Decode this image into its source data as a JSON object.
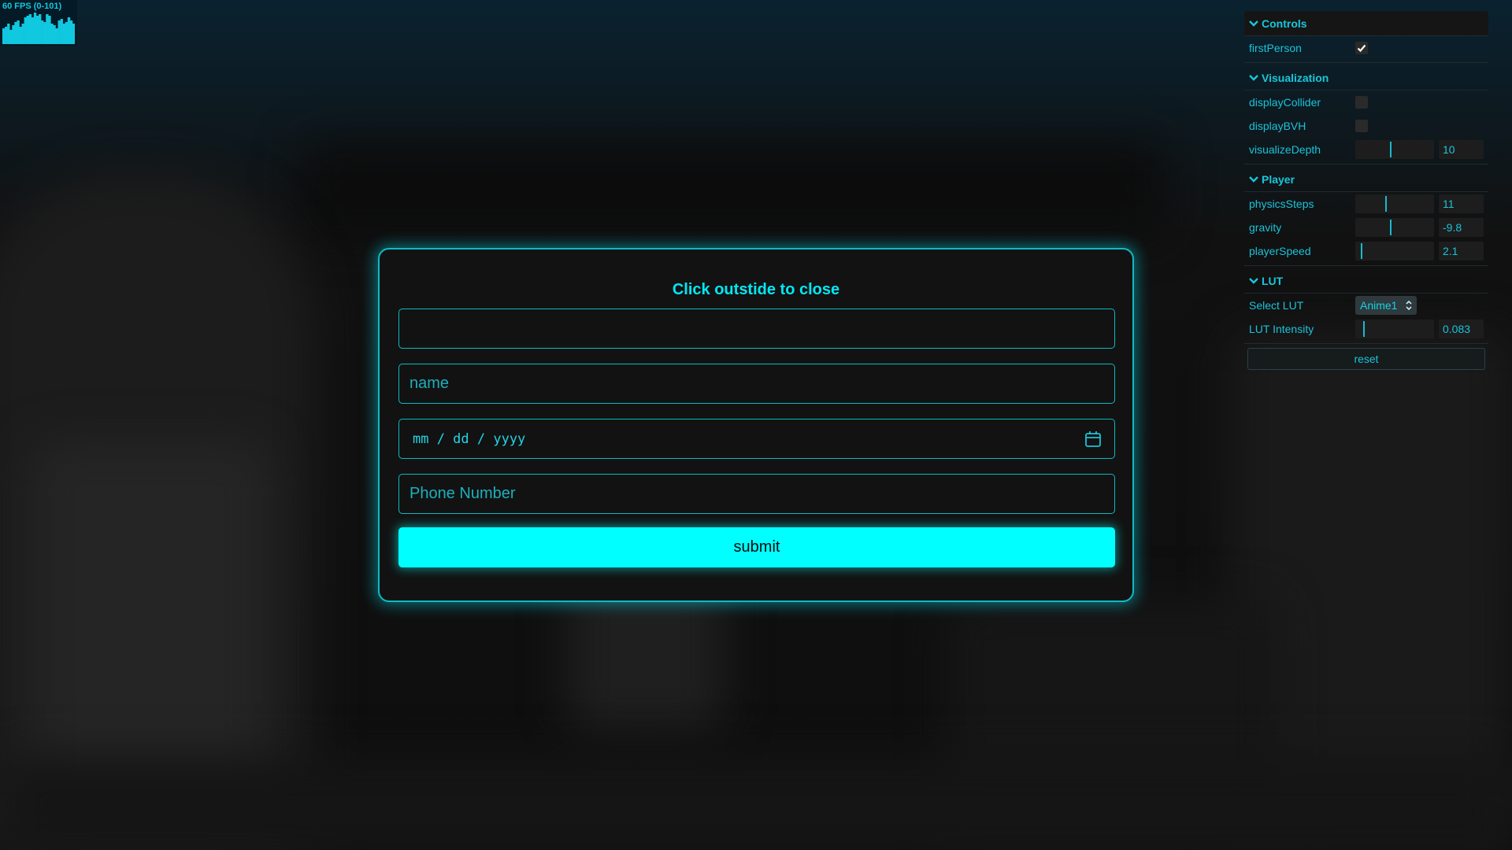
{
  "fps": {
    "label": "60 FPS (0-101)",
    "bars": [
      20,
      22,
      26,
      18,
      24,
      28,
      30,
      22,
      26,
      34,
      36,
      38,
      34,
      40,
      36,
      38,
      30,
      28,
      38,
      36,
      26,
      24,
      20,
      30,
      32,
      26,
      28,
      34,
      30,
      26
    ]
  },
  "modal": {
    "title": "Click outstide to close",
    "field1_placeholder": "",
    "name_placeholder": "name",
    "date_placeholder": "mm / dd / yyyy",
    "phone_placeholder": "Phone Number",
    "submit_label": "submit"
  },
  "gui": {
    "controls": {
      "title": "Controls",
      "first_person_label": "firstPerson",
      "first_person": true
    },
    "visualization": {
      "title": "Visualization",
      "display_collider_label": "displayCollider",
      "display_bvh_label": "displayBVH",
      "visualize_depth_label": "visualizeDepth",
      "visualize_depth_value": "10",
      "visualize_depth_fraction": 0.44
    },
    "player": {
      "title": "Player",
      "physics_steps_label": "physicsSteps",
      "physics_steps_value": "11",
      "physics_steps_fraction": 0.37,
      "gravity_label": "gravity",
      "gravity_value": "-9.8",
      "gravity_fraction": 0.44,
      "player_speed_label": "playerSpeed",
      "player_speed_value": "2.1",
      "player_speed_fraction": 0.05
    },
    "lut": {
      "title": "LUT",
      "select_label": "Select LUT",
      "select_value": "Anime1",
      "intensity_label": "LUT Intensity",
      "intensity_value": "0.083",
      "intensity_fraction": 0.08
    },
    "reset_label": "reset"
  },
  "colors": {
    "accent": "#00ffff",
    "text_accent": "#1ac3da",
    "panel": "#121212"
  }
}
